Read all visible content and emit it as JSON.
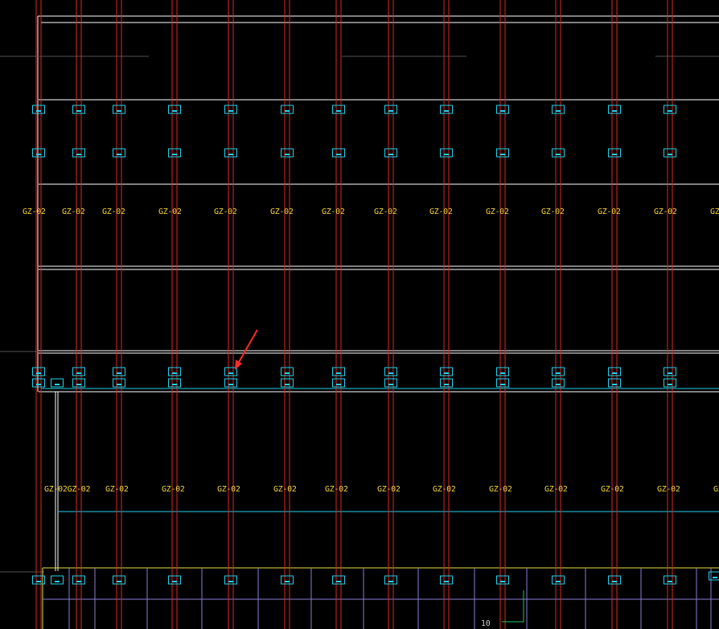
{
  "drawing": {
    "column_tag": "GZ-02",
    "axis_number": "10",
    "colors": {
      "background": "#000000",
      "outline": "#ffffff",
      "column": "#e0271f",
      "marker": "#22d3ee",
      "label": "#f5d33b",
      "grid": "#8b7bd8",
      "footing_edge": "#e5e04a",
      "axis": "#22c55e",
      "arrow": "#ff2a2a"
    },
    "columns_visible": 13,
    "label_rows": [
      {
        "row": "upper",
        "labels": [
          "GZ-02",
          "GZ-02",
          "GZ-02",
          "GZ-02",
          "GZ-02",
          "GZ-02",
          "GZ-02",
          "GZ-02",
          "GZ-02",
          "GZ-02",
          "GZ-02",
          "GZ-02",
          "GZ-02",
          "GZ"
        ]
      },
      {
        "row": "lower",
        "labels": [
          "GZ-02GZ-02",
          "GZ-02",
          "GZ-02",
          "GZ-02",
          "GZ-02",
          "GZ-02",
          "GZ-02",
          "GZ-02",
          "GZ-02",
          "GZ-02",
          "GZ-02",
          "GZ-02",
          "GZ-"
        ]
      }
    ]
  }
}
